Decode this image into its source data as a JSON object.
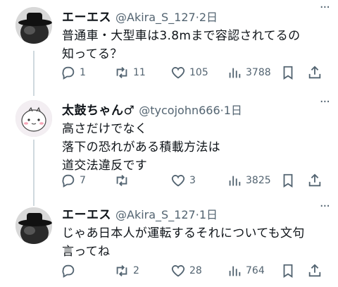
{
  "tweets": [
    {
      "name": "エーエス",
      "handle": "@Akira_S_127",
      "sep": "·",
      "time": "2日",
      "lines": [
        "普通車・大型車は3.8mまで容認されてるの",
        "知ってる？"
      ],
      "replies": "1",
      "retweets": "11",
      "likes": "105",
      "views": "3788"
    },
    {
      "name": "太鼓ちゃん♂",
      "handle": "@tycojohn666",
      "sep": "·",
      "time": "1日",
      "lines": [
        "高さだけでなく",
        "落下の恐れがある積載方法は",
        "道交法違反です"
      ],
      "replies": "7",
      "retweets": "",
      "likes": "3",
      "views": "3825"
    },
    {
      "name": "エーエス",
      "handle": "@Akira_S_127",
      "sep": "·",
      "time": "1日",
      "lines": [
        "じゃあ日本人が運転するそれについても文句",
        "言ってね"
      ],
      "replies": "",
      "retweets": "2",
      "likes": "28",
      "views": "764"
    }
  ],
  "icons": {
    "reply": "reply-icon",
    "retweet": "retweet-icon",
    "like": "heart-icon",
    "views": "views-icon",
    "bookmark": "bookmark-icon",
    "share": "share-icon",
    "more": "more-icon"
  },
  "colors": {
    "text": "#0f1419",
    "secondary": "#536471",
    "thread_line": "#cfd9de"
  }
}
